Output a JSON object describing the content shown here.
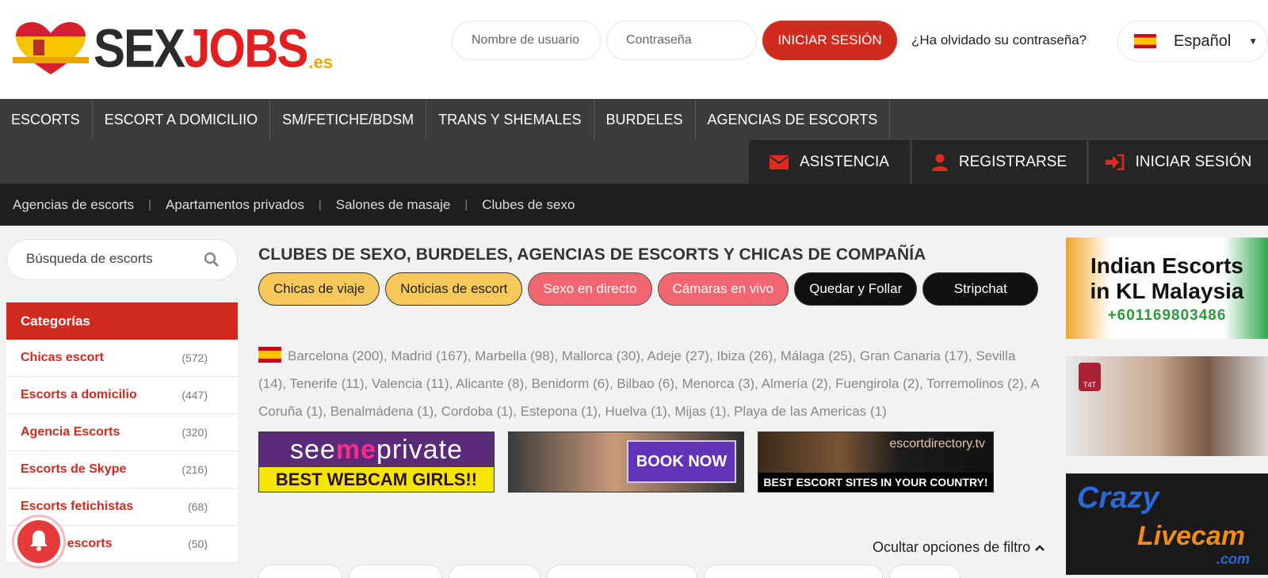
{
  "header": {
    "logo": {
      "sex": "SEX",
      "jobs": "JOBS",
      "tld": ".es"
    },
    "username_placeholder": "Nombre de usuario",
    "password_placeholder": "Contraseña",
    "login_button": "INICIAR SESIÓN",
    "forgot_link": "¿Ha olvidado su contraseña?",
    "language": "Español"
  },
  "nav": {
    "main": [
      "ESCORTS",
      "ESCORT A DOMICILIIO",
      "SM/FETICHE/BDSM",
      "TRANS Y SHEMALES",
      "BURDELES",
      "AGENCIAS DE ESCORTS"
    ],
    "account": [
      {
        "label": "ASISTENCIA",
        "icon": "envelope-icon"
      },
      {
        "label": "REGISTRARSE",
        "icon": "user-icon"
      },
      {
        "label": "INICIAR SESIÓN",
        "icon": "sign-in-icon"
      }
    ],
    "sub": [
      "Agencias de escorts",
      "Apartamentos privados",
      "Salones de masaje",
      "Clubes de sexo"
    ]
  },
  "sidebar": {
    "search_placeholder": "Búsqueda de escorts",
    "categories_title": "Categorías",
    "categories": [
      {
        "name": "Chicas escort",
        "count": "(572)"
      },
      {
        "name": "Escorts a domicilio",
        "count": "(447)"
      },
      {
        "name": "Agencia Escorts",
        "count": "(320)"
      },
      {
        "name": "Escorts de Skype",
        "count": "(216)"
      },
      {
        "name": "Escorts fetichistas",
        "count": "(68)"
      },
      {
        "name": "...as de escorts",
        "count": "(50)"
      }
    ]
  },
  "main": {
    "title": "CLUBES DE SEXO, BURDELES, AGENCIAS DE ESCORTS Y CHICAS DE COMPAÑÍA",
    "pills": [
      {
        "label": "Chicas de viaje",
        "style": "yellow"
      },
      {
        "label": "Noticias de escort",
        "style": "yellow"
      },
      {
        "label": "Sexo en directo",
        "style": "red"
      },
      {
        "label": "Cámaras en vivo",
        "style": "red"
      },
      {
        "label": "Quedar y Follar",
        "style": "black"
      },
      {
        "label": "Stripchat",
        "style": "black"
      }
    ],
    "cities": "Barcelona (200), Madrid (167), Marbella (98), Mallorca (30), Adeje (27), Ibiza (26), Málaga (25), Gran Canaria (17), Sevilla (14), Tenerife (11), Valencia (11), Alicante (8), Benidorm (6), Bilbao (6), Menorca (3), Almería (2), Fuengirola (2), Torremolinos (2), A Coruña (1), Benalmádena (1), Cordoba (1), Estepona (1), Huelva (1), Mijas (1), Playa de las Americas (1)",
    "banners": {
      "b1_see": "see",
      "b1_me": "me",
      "b1_private": "private",
      "b1_tagline": "BEST WEBCAM GIRLS!!",
      "b2_button": "BOOK NOW",
      "b3_brand": "escortdirectory.tv",
      "b3_tagline": "BEST ESCORT SITES IN YOUR COUNTRY!"
    },
    "filter_toggle": "Ocultar opciones de filtro"
  },
  "ads": {
    "ad1_line1": "Indian Escorts",
    "ad1_line2": "in KL Malaysia",
    "ad1_phone": "+601169803486",
    "ad2_logo": "T4T",
    "ad3_w1": "Crazy",
    "ad3_w2": "Livecam",
    "ad3_w3": ".com"
  },
  "colors": {
    "accent_red": "#d12a1e",
    "nav_dark": "#3c3c3c",
    "pill_yellow": "#f7c95a",
    "pill_red": "#f26670"
  }
}
